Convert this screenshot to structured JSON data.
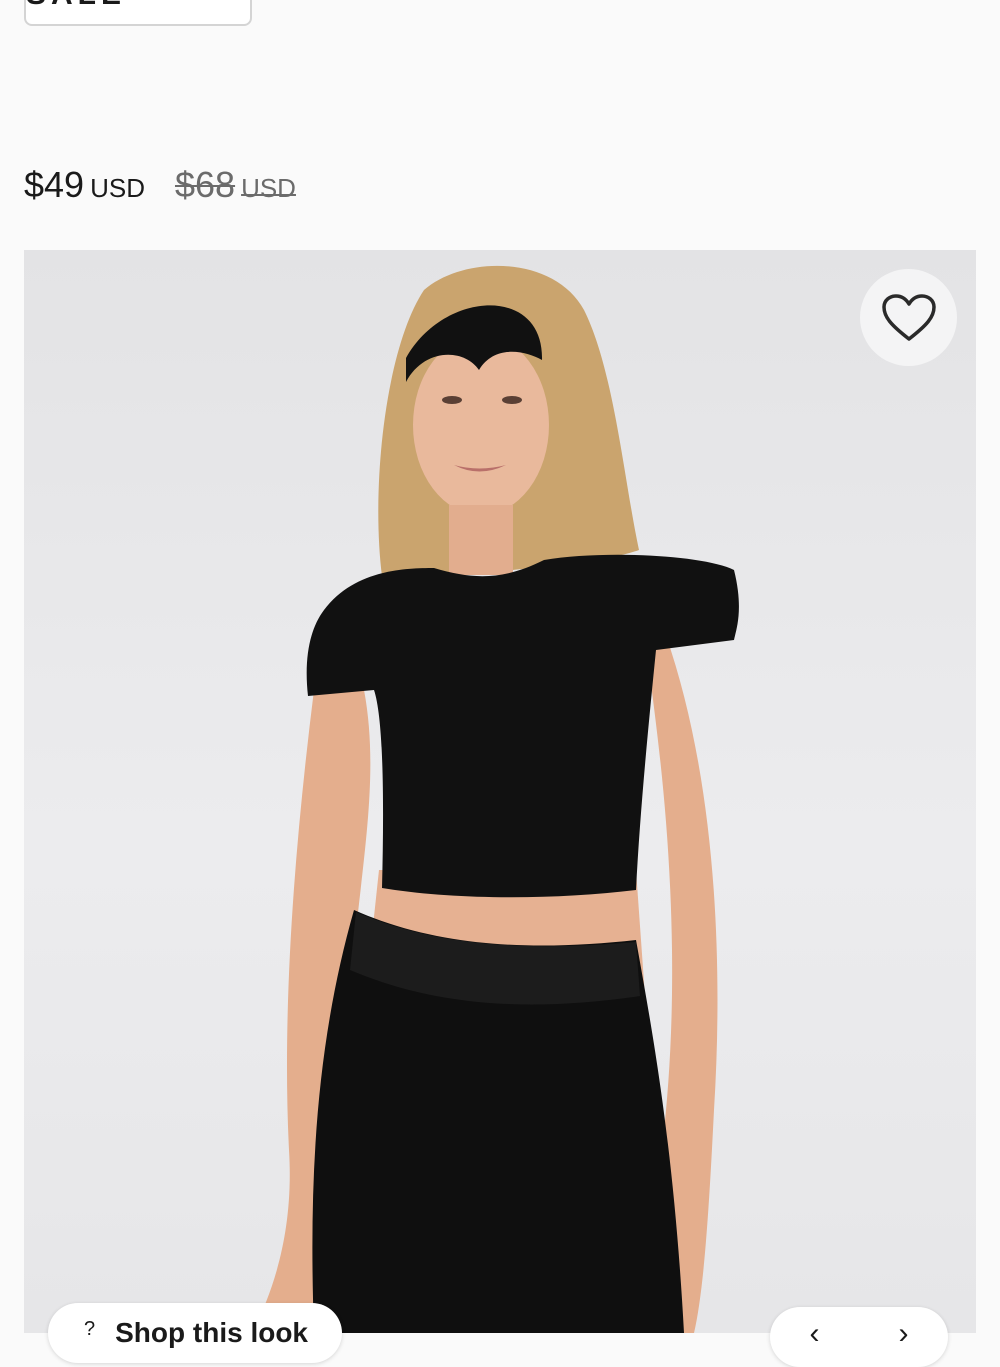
{
  "badge": {
    "label": "FINAL SALE"
  },
  "pricing": {
    "sale_price": "$49",
    "sale_currency": "USD",
    "original_price": "$68",
    "original_currency": "USD"
  },
  "wishlist": {
    "icon": "heart-outline-icon"
  },
  "shop_look": {
    "icon": "hanger-icon",
    "label": "Shop this look"
  },
  "carousel": {
    "prev_icon": "chevron-left-icon",
    "next_icon": "chevron-right-icon",
    "prev_glyph": "‹",
    "next_glyph": "›"
  },
  "colors": {
    "background": "#fafafa",
    "photo_backdrop": "#e8e8ea",
    "garment": "#111111",
    "text": "#1a1a1a"
  }
}
